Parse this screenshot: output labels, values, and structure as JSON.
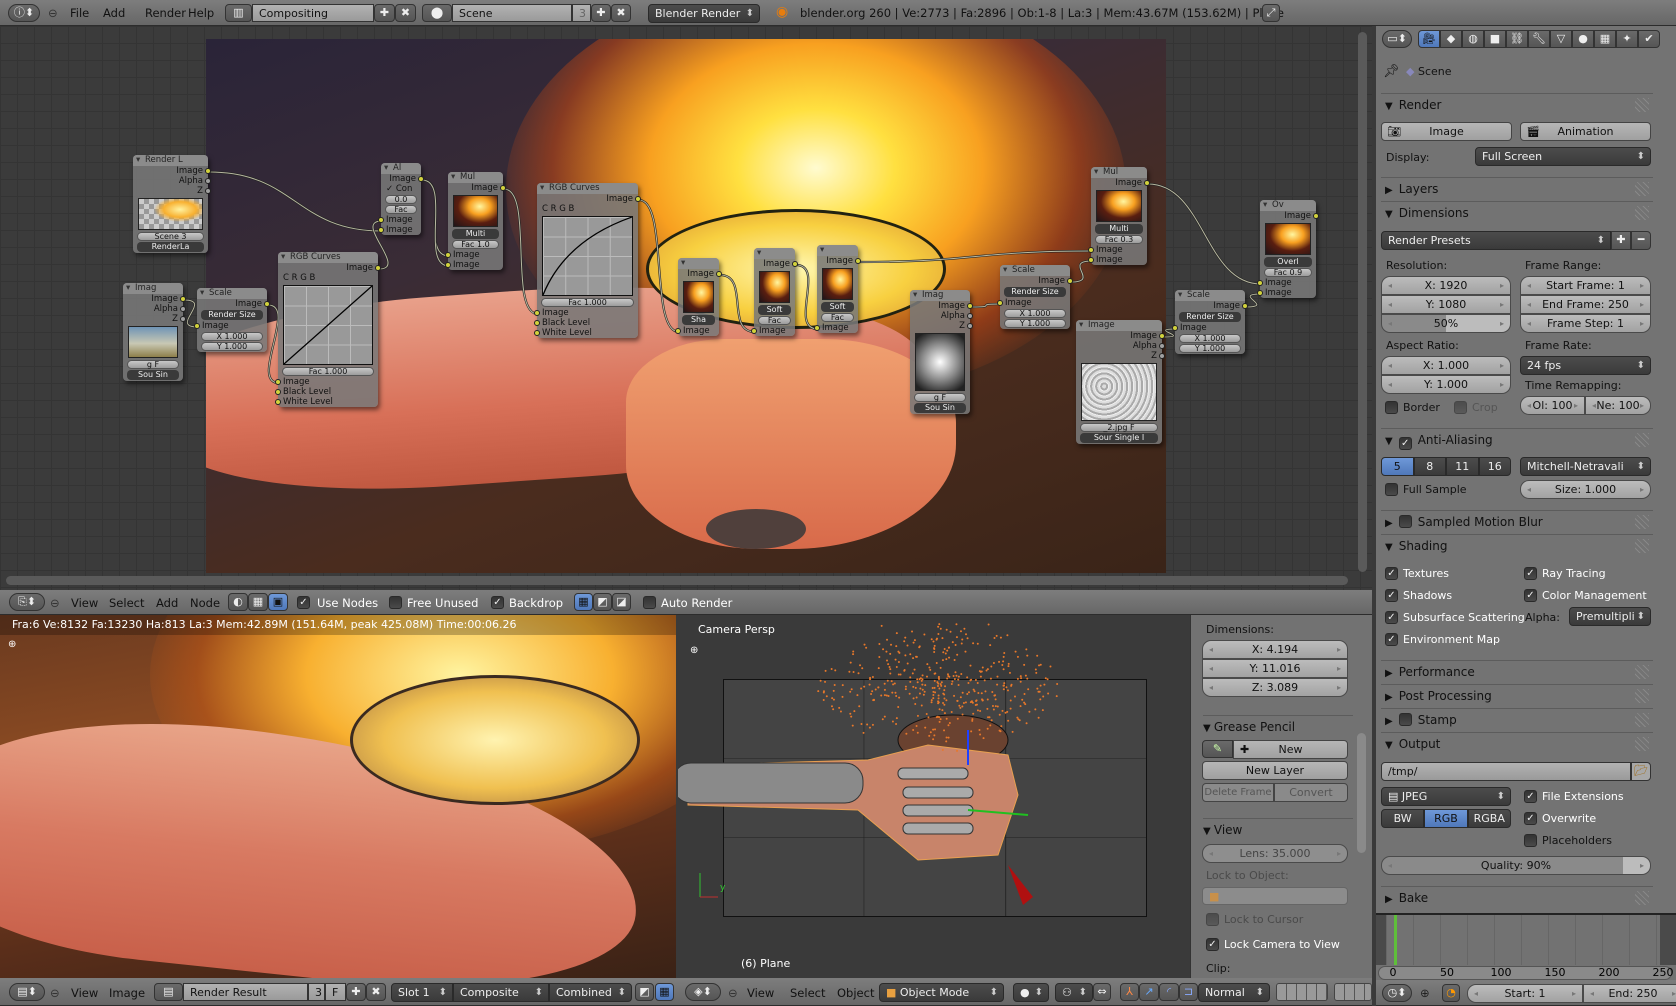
{
  "top_header": {
    "menus": [
      "File",
      "Add",
      "Render",
      "Help"
    ],
    "screen": "Compositing",
    "scene": "Scene",
    "scene_users": "3",
    "engine": "Blender Render",
    "stats": "blender.org 260 | Ve:2773 | Fa:2896 | Ob:1-8 | La:3 | Mem:43.67M (153.62M) | Plane"
  },
  "node_editor": {
    "header": {
      "menus": [
        "View",
        "Select",
        "Add",
        "Node"
      ],
      "use_nodes": "Use Nodes",
      "use_nodes_checked": true,
      "free_unused": "Free Unused",
      "free_unused_checked": false,
      "backdrop": "Backdrop",
      "backdrop_checked": true,
      "auto_render": "Auto Render",
      "auto_render_checked": false
    },
    "nodes": [
      {
        "title": "Render L",
        "rows": [
          {
            "kind": "out",
            "text": "Image"
          },
          {
            "kind": "out",
            "text": "Alpha",
            "sock": "gray"
          },
          {
            "kind": "out",
            "text": "Z",
            "sock": "gray"
          },
          {
            "kind": "preview",
            "preview": "fchk"
          },
          {
            "kind": "pill",
            "text": "Scene 3"
          },
          {
            "kind": "menu",
            "text": "RenderLa"
          }
        ]
      },
      {
        "title": "Imag",
        "rows": [
          {
            "kind": "out",
            "text": "Image"
          },
          {
            "kind": "out",
            "text": "Alpha",
            "sock": "gray"
          },
          {
            "kind": "out",
            "text": "Z",
            "sock": "gray"
          },
          {
            "kind": "preview",
            "preview": "sky"
          },
          {
            "kind": "pill",
            "text": "g F"
          },
          {
            "kind": "menu",
            "text": "Sou  Sin"
          }
        ]
      },
      {
        "title": "Scale",
        "rows": [
          {
            "kind": "out",
            "text": "Image"
          },
          {
            "kind": "menu",
            "text": "Render Size"
          },
          {
            "kind": "in",
            "text": "Image"
          },
          {
            "kind": "pill",
            "text": "X 1.000"
          },
          {
            "kind": "pill",
            "text": "Y 1.000"
          }
        ]
      },
      {
        "title": "RGB Curves",
        "rows": [
          {
            "kind": "out",
            "text": "Image"
          },
          {
            "kind": "text",
            "text": "C R G B"
          },
          {
            "kind": "curve",
            "curve": "linear"
          },
          {
            "kind": "pill",
            "text": "Fac 1.000"
          },
          {
            "kind": "in",
            "text": "Image"
          },
          {
            "kind": "in",
            "text": "Black Level"
          },
          {
            "kind": "in",
            "text": "White Level"
          }
        ]
      },
      {
        "title": "Al",
        "rows": [
          {
            "kind": "out",
            "text": "Image"
          },
          {
            "kind": "text",
            "text": "✓ Con"
          },
          {
            "kind": "pill",
            "text": "0.0"
          },
          {
            "kind": "pill",
            "text": "Fac"
          },
          {
            "kind": "in",
            "text": "Image"
          },
          {
            "kind": "in",
            "text": "Image"
          }
        ]
      },
      {
        "title": "Mul",
        "rows": [
          {
            "kind": "out",
            "text": "Image"
          },
          {
            "kind": "preview",
            "preview": "fire"
          },
          {
            "kind": "menu",
            "text": "Multi"
          },
          {
            "kind": "pill",
            "text": "Fac 1.0"
          },
          {
            "kind": "in",
            "text": "Image"
          },
          {
            "kind": "in",
            "text": "Image"
          }
        ]
      },
      {
        "title": "RGB Curves",
        "rows": [
          {
            "kind": "out",
            "text": "Image"
          },
          {
            "kind": "text",
            "text": "C R G B"
          },
          {
            "kind": "curve",
            "curve": "convex"
          },
          {
            "kind": "pill",
            "text": "Fac 1.000"
          },
          {
            "kind": "in",
            "text": "Image"
          },
          {
            "kind": "in",
            "text": "Black Level"
          },
          {
            "kind": "in",
            "text": "White Level"
          }
        ]
      },
      {
        "title": "",
        "rows": [
          {
            "kind": "out",
            "text": "Image"
          },
          {
            "kind": "preview",
            "preview": "fire"
          },
          {
            "kind": "menu",
            "text": "Sha"
          },
          {
            "kind": "in",
            "text": "Image"
          }
        ]
      },
      {
        "title": "",
        "rows": [
          {
            "kind": "out",
            "text": "Image"
          },
          {
            "kind": "preview",
            "preview": "fire"
          },
          {
            "kind": "menu",
            "text": "Soft"
          },
          {
            "kind": "pill",
            "text": "Fac"
          },
          {
            "kind": "in",
            "text": "Image"
          }
        ]
      },
      {
        "title": "",
        "rows": [
          {
            "kind": "out",
            "text": "Image"
          },
          {
            "kind": "preview",
            "preview": "fire"
          },
          {
            "kind": "menu",
            "text": "Soft"
          },
          {
            "kind": "pill",
            "text": "Fac"
          },
          {
            "kind": "in",
            "text": "Image"
          }
        ]
      },
      {
        "title": "Imag",
        "rows": [
          {
            "kind": "out",
            "text": "Image"
          },
          {
            "kind": "out",
            "text": "Alpha",
            "sock": "gray"
          },
          {
            "kind": "out",
            "text": "Z",
            "sock": "gray"
          },
          {
            "kind": "preview",
            "preview": "sph",
            "tall": true
          },
          {
            "kind": "pill",
            "text": "g F"
          },
          {
            "kind": "menu",
            "text": "Sou  Sin"
          }
        ]
      },
      {
        "title": "Scale",
        "rows": [
          {
            "kind": "out",
            "text": "Image"
          },
          {
            "kind": "menu",
            "text": "Render Size"
          },
          {
            "kind": "in",
            "text": "Image"
          },
          {
            "kind": "pill",
            "text": "X 1.000"
          },
          {
            "kind": "pill",
            "text": "Y 1.000"
          }
        ]
      },
      {
        "title": "Mul",
        "rows": [
          {
            "kind": "out",
            "text": "Image"
          },
          {
            "kind": "preview",
            "preview": "fire"
          },
          {
            "kind": "menu",
            "text": "Multi"
          },
          {
            "kind": "pill",
            "text": "Fac 0.3"
          },
          {
            "kind": "in",
            "text": "Image"
          },
          {
            "kind": "in",
            "text": "Image"
          }
        ]
      },
      {
        "title": "Image",
        "rows": [
          {
            "kind": "out",
            "text": "Image"
          },
          {
            "kind": "out",
            "text": "Alpha",
            "sock": "gray"
          },
          {
            "kind": "out",
            "text": "Z",
            "sock": "gray"
          },
          {
            "kind": "preview",
            "preview": "noise",
            "tall": true
          },
          {
            "kind": "pill",
            "text": "_2.jpg F"
          },
          {
            "kind": "menu",
            "text": "Sour  Single I"
          }
        ]
      },
      {
        "title": "Scale",
        "rows": [
          {
            "kind": "out",
            "text": "Image"
          },
          {
            "kind": "menu",
            "text": "Render Size"
          },
          {
            "kind": "in",
            "text": "Image"
          },
          {
            "kind": "pill",
            "text": "X 1.000"
          },
          {
            "kind": "pill",
            "text": "Y 1.000"
          }
        ]
      },
      {
        "title": "Ov",
        "rows": [
          {
            "kind": "out",
            "text": "Image"
          },
          {
            "kind": "preview",
            "preview": "fire"
          },
          {
            "kind": "menu",
            "text": "Overl"
          },
          {
            "kind": "pill",
            "text": "Fac 0.9"
          },
          {
            "kind": "in",
            "text": "Image"
          },
          {
            "kind": "in",
            "text": "Image"
          }
        ]
      }
    ]
  },
  "image_editor": {
    "status": "Fra:6  Ve:8132 Fa:13230 Ha:813 La:3 Mem:42.89M (151.64M, peak 425.08M) Time:00:06.26",
    "header": {
      "menus": [
        "View",
        "Image"
      ],
      "image": "Render Result",
      "users": "3",
      "fake": "F",
      "slot": "Slot 1",
      "pass_layer": "Composite",
      "pass": "Combined"
    }
  },
  "viewport": {
    "label": "Camera Persp",
    "object_info": "(6) Plane",
    "header": {
      "menus": [
        "View",
        "Select",
        "Object"
      ],
      "mode": "Object Mode",
      "orientation": "Normal"
    }
  },
  "n_panel": {
    "dimensions_label": "Dimensions:",
    "dimensions": [
      "X: 4.194",
      "Y: 11.016",
      "Z: 3.089"
    ],
    "grease_pencil": "Grease Pencil",
    "new": "New",
    "new_layer": "New Layer",
    "delete_frame": "Delete Frame",
    "convert": "Convert",
    "view": "View",
    "lens": "Lens: 35.000",
    "lock_object": "Lock to Object:",
    "lock_cursor": "Lock to Cursor",
    "lock_cursor_checked": false,
    "lock_camera": "Lock Camera to View",
    "lock_camera_checked": true,
    "clip": "Clip:"
  },
  "properties": {
    "context": "Scene",
    "render": {
      "title": "Render",
      "image": "Image",
      "animation": "Animation",
      "display_label": "Display:",
      "display": "Full Screen"
    },
    "layers": "Layers",
    "dimensions": {
      "title": "Dimensions",
      "presets": "Render Presets",
      "resolution_label": "Resolution:",
      "res_x": "X: 1920",
      "res_y": "Y: 1080",
      "res_pct": "50%",
      "res_pct_value": 50,
      "frame_range_label": "Frame Range:",
      "start": "Start Frame: 1",
      "end": "End Frame: 250",
      "step": "Frame Step: 1",
      "aspect_label": "Aspect Ratio:",
      "asp_x": "X: 1.000",
      "asp_y": "Y: 1.000",
      "frame_rate_label": "Frame Rate:",
      "frame_rate": "24 fps",
      "remap_label": "Time Remapping:",
      "remap_old": "Ol: 100",
      "remap_new": "Ne: 100",
      "border": "Border",
      "border_checked": false,
      "crop": "Crop",
      "crop_checked": false
    },
    "aa": {
      "title": "Anti-Aliasing",
      "checked": true,
      "samples": [
        "5",
        "8",
        "11",
        "16"
      ],
      "selected": "5",
      "filter": "Mitchell-Netravali",
      "full_sample": "Full Sample",
      "full_sample_checked": false,
      "size": "Size: 1.000"
    },
    "motion_blur": {
      "title": "Sampled Motion Blur",
      "checked": false
    },
    "shading": {
      "title": "Shading",
      "textures": "Textures",
      "shadows": "Shadows",
      "sss": "Subsurface Scattering",
      "envmap": "Environment Map",
      "raytracing": "Ray Tracing",
      "color_management": "Color Management",
      "alpha_label": "Alpha:",
      "alpha": "Premultipli"
    },
    "performance": "Performance",
    "post_processing": "Post Processing",
    "stamp": {
      "title": "Stamp",
      "checked": false
    },
    "output": {
      "title": "Output",
      "path": "/tmp/",
      "format": "JPEG",
      "modes": [
        "BW",
        "RGB",
        "RGBA"
      ],
      "selected_mode": "RGB",
      "file_extensions": "File Extensions",
      "overwrite": "Overwrite",
      "placeholders": "Placeholders",
      "placeholders_checked": false,
      "quality": "Quality: 90%",
      "quality_value": 90
    },
    "bake": "Bake"
  },
  "timeline": {
    "ticks": [
      "0",
      "50",
      "100",
      "150",
      "200",
      "250"
    ],
    "current_frame": 6,
    "start": "Start: 1",
    "end": "End: 250"
  },
  "colors": {
    "accent": "#5680c2",
    "socket": "#d2d23c",
    "frame": "#5fbf3a"
  }
}
